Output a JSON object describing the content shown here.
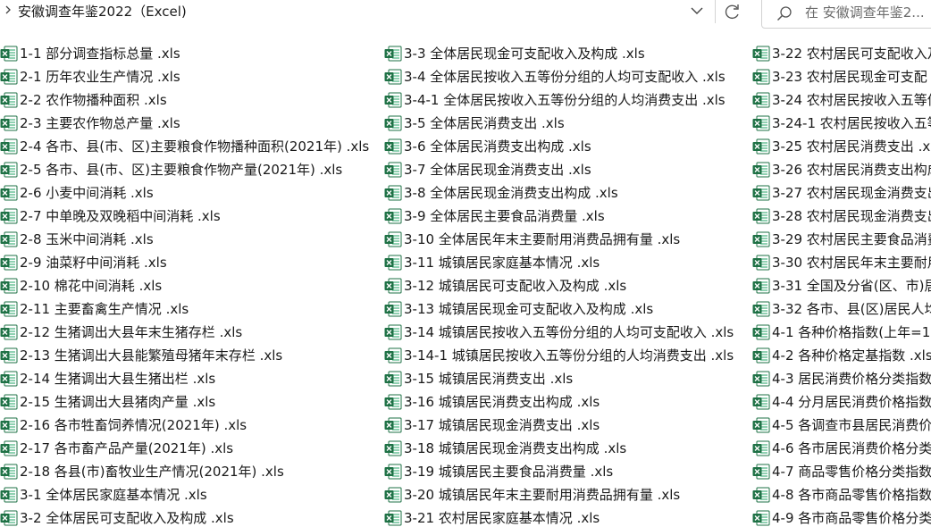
{
  "address": {
    "path": "安徽调查年鉴2022（Excel)",
    "search_placeholder": "在 安徽调查年鉴2..."
  },
  "icons": {
    "back": "chevron-right-icon",
    "history": "chevron-down-icon",
    "refresh": "refresh-icon",
    "search": "search-icon",
    "file": "excel-file-icon"
  },
  "colors": {
    "excel_green": "#1e7145",
    "excel_light": "#21a366"
  },
  "files": {
    "col1": [
      "1-1 部分调查指标总量 .xls",
      "2-1 历年农业生产情况 .xls",
      "2-2 农作物播种面积 .xls",
      "2-3 主要农作物总产量 .xls",
      "2-4 各市、县(市、区)主要粮食作物播种面积(2021年) .xls",
      "2-5 各市、县(市、区)主要粮食作物产量(2021年) .xls",
      "2-6 小麦中间消耗 .xls",
      "2-7 中单晚及双晚稻中间消耗 .xls",
      "2-8 玉米中间消耗 .xls",
      "2-9 油菜籽中间消耗 .xls",
      "2-10 棉花中间消耗 .xls",
      "2-11 主要畜禽生产情况 .xls",
      "2-12 生猪调出大县年末生猪存栏 .xls",
      "2-13 生猪调出大县能繁殖母猪年末存栏 .xls",
      "2-14 生猪调出大县生猪出栏 .xls",
      "2-15 生猪调出大县猪肉产量 .xls",
      "2-16 各市牲畜饲养情况(2021年) .xls",
      "2-17 各市畜产品产量(2021年) .xls",
      "2-18 各县(市)畜牧业生产情况(2021年) .xls",
      "3-1 全体居民家庭基本情况 .xls",
      "3-2 全体居民可支配收入及构成 .xls"
    ],
    "col2": [
      "3-3 全体居民现金可支配收入及构成 .xls",
      "3-4 全体居民按收入五等份分组的人均可支配收入 .xls",
      "3-4-1 全体居民按收入五等份分组的人均消费支出 .xls",
      "3-5 全体居民消费支出 .xls",
      "3-6 全体居民消费支出构成 .xls",
      "3-7 全体居民现金消费支出 .xls",
      "3-8 全体居民现金消费支出构成 .xls",
      "3-9 全体居民主要食品消费量 .xls",
      "3-10 全体居民年末主要耐用消费品拥有量 .xls",
      "3-11 城镇居民家庭基本情况 .xls",
      "3-12 城镇居民可支配收入及构成 .xls",
      "3-13 城镇居民现金可支配收入及构成 .xls",
      "3-14 城镇居民按收入五等份分组的人均可支配收入 .xls",
      "3-14-1 城镇居民按收入五等份分组的人均消费支出 .xls",
      "3-15 城镇居民消费支出 .xls",
      "3-16 城镇居民消费支出构成 .xls",
      "3-17 城镇居民现金消费支出 .xls",
      "3-18 城镇居民现金消费支出构成 .xls",
      "3-19 城镇居民主要食品消费量 .xls",
      "3-20 城镇居民年末主要耐用消费品拥有量 .xls",
      "3-21 农村居民家庭基本情况 .xls"
    ],
    "col3": [
      "3-22 农村居民可支配收入及",
      "3-23 农村居民现金可支配",
      "3-24 农村居民按收入五等份",
      "3-24-1 农村居民按收入五等",
      "3-25 农村居民消费支出 .xls",
      "3-26 农村居民消费支出构成",
      "3-27 农村居民现金消费支出",
      "3-28 农村居民现金消费支出",
      "3-29 农村居民主要食品消费",
      "3-30 农村居民年末主要耐用",
      "3-31 全国及分省(区、市)居",
      "3-32 各市、县(区)居民人均",
      "4-1 各种价格指数(上年=10",
      "4-2 各种价格定基指数 .xls",
      "4-3 居民消费价格分类指数",
      "4-4 分月居民消费价格指数",
      "4-5 各调查市县居民消费价",
      "4-6 各市居民消费价格分类",
      "4-7 商品零售价格分类指数",
      "4-8 各市商品零售价格指数",
      "4-9 各市商品零售价格分类"
    ]
  }
}
